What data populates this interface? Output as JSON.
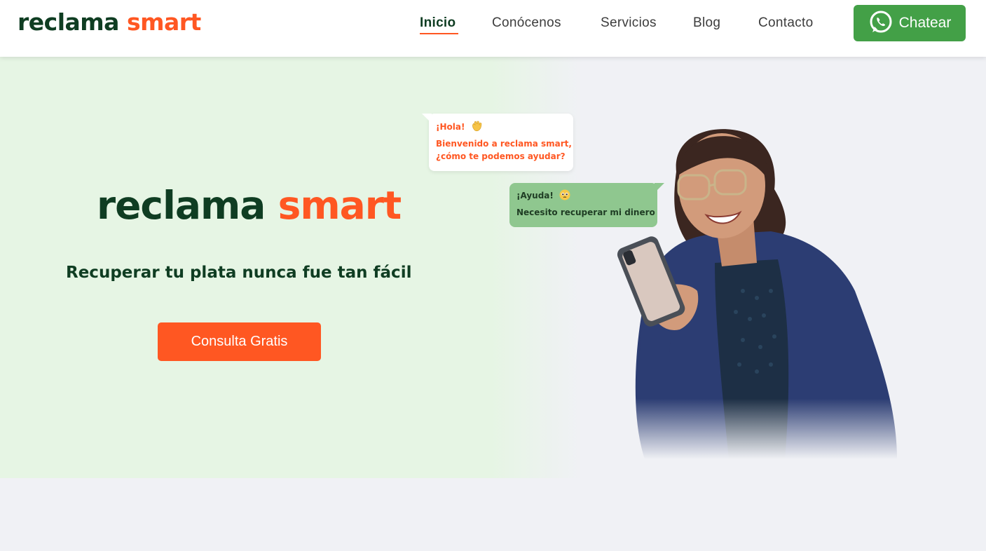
{
  "header": {
    "logo": {
      "part1": "reclama",
      "part2": "smart"
    },
    "nav": [
      {
        "label": "Inicio",
        "active": true
      },
      {
        "label": "Conócenos",
        "active": false
      },
      {
        "label": "Servicios",
        "active": false
      },
      {
        "label": "Blog",
        "active": false
      },
      {
        "label": "Contacto",
        "active": false
      }
    ],
    "chat_button": {
      "label": "Chatear",
      "icon": "whatsapp-icon"
    }
  },
  "hero": {
    "logo": {
      "part1": "reclama",
      "part2": "smart"
    },
    "tagline": "Recuperar tu plata nunca fue tan fácil",
    "cta_label": "Consulta Gratis",
    "bubble_incoming": {
      "greeting": "¡Hola!",
      "greeting_icon": "waving-hand-emoji",
      "message_line1": "Bienvenido a reclama smart,",
      "message_line2": "¿cómo te podemos ayudar?"
    },
    "bubble_outgoing": {
      "greeting": "¡Ayuda!",
      "greeting_icon": "pleading-face-emoji",
      "message": "Necesito recuperar mi dinero"
    },
    "image": "woman-smiling-with-phone"
  },
  "colors": {
    "brand_dark": "#0f3d22",
    "brand_orange": "#ff5722",
    "whatsapp_green": "#43a047",
    "hero_bg": "#e6f5e4",
    "page_bg": "#f0f1f5",
    "bubble_green": "#8fc78f"
  }
}
